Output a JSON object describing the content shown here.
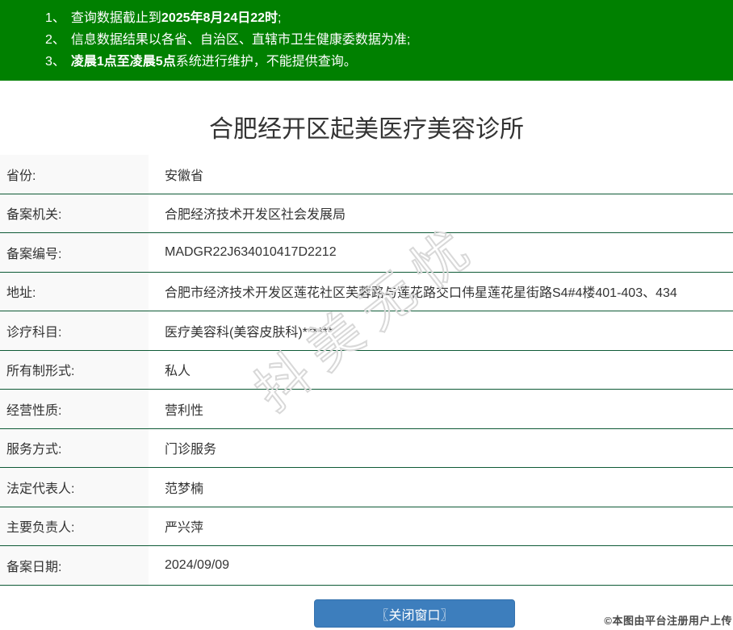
{
  "header": {
    "bg_color": "#008000",
    "notices": [
      {
        "num": "1、",
        "pre": "查询数据截止到",
        "bold": "2025年8月24日22时",
        "post": ";"
      },
      {
        "num": "2、",
        "pre": "信息数据结果以各省、自治区、直辖市卫生健康委数据为准;",
        "bold": "",
        "post": ""
      },
      {
        "num": "3、",
        "pre": "",
        "bold": "凌晨1点至凌晨5点",
        "post": "系统进行维护，不能提供查询。"
      }
    ]
  },
  "title": "合肥经开区起美医疗美容诊所",
  "table": {
    "divider_color": "#0e5a36",
    "label_bg_color": "#f9f9f9",
    "rows": [
      {
        "label": "省份:",
        "value": "安徽省"
      },
      {
        "label": "备案机关:",
        "value": "合肥经济技术开发区社会发展局"
      },
      {
        "label": "备案编号:",
        "value": "MADGR22J634010417D2212"
      },
      {
        "label": "地址:",
        "value": "合肥市经济技术开发区莲花社区芙蓉路与莲花路交口伟星莲花星街路S4#4楼401-403、434"
      },
      {
        "label": "诊疗科目:",
        "value": "医疗美容科(美容皮肤科)******"
      },
      {
        "label": "所有制形式:",
        "value": "私人"
      },
      {
        "label": "经营性质:",
        "value": "营利性"
      },
      {
        "label": "服务方式:",
        "value": "门诊服务"
      },
      {
        "label": "法定代表人:",
        "value": "范梦楠"
      },
      {
        "label": "主要负责人:",
        "value": "严兴萍"
      },
      {
        "label": "备案日期:",
        "value": "2024/09/09"
      }
    ]
  },
  "watermark": {
    "text": "抖美无忧",
    "stroke_color": "#d8d8d8"
  },
  "close_button": {
    "label": "〖关闭窗口〗",
    "bg_color": "#3d7ebd",
    "text_color": "#ffffff"
  },
  "footer_note": {
    "text": "©本图由平台注册用户上传"
  }
}
